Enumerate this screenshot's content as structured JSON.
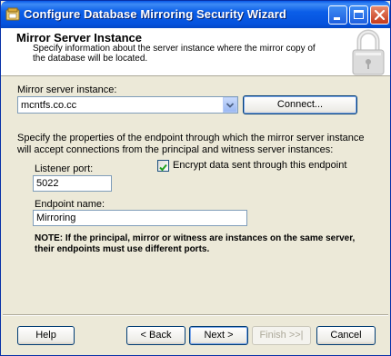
{
  "window": {
    "title": "Configure Database Mirroring Security Wizard",
    "caption_buttons": [
      "minimize-icon",
      "maximize-icon",
      "close-icon"
    ]
  },
  "header": {
    "title": "Mirror Server Instance",
    "description": "Specify information about the server instance where the mirror copy of the database will be located.",
    "icon": "padlock-icon"
  },
  "mirror": {
    "label": "Mirror server instance:",
    "value": "mcntfs.co.cc",
    "connect_label": "Connect..."
  },
  "endpoint": {
    "description": "Specify the properties of the endpoint through which the mirror server instance will accept connections from the principal and witness server instances:",
    "listener_label": "Listener port:",
    "listener_value": "5022",
    "encrypt_label": "Encrypt data sent through this endpoint",
    "encrypt_checked": true,
    "name_label": "Endpoint name:",
    "name_value": "Mirroring",
    "note": "NOTE: If the principal, mirror or witness are instances on the same server, their endpoints must use different ports."
  },
  "footer": {
    "help": "Help",
    "back": "< Back",
    "next": "Next >",
    "finish": "Finish >>|",
    "cancel": "Cancel"
  },
  "colors": {
    "titlebar": "#0a5ae9",
    "dialog_bg": "#ece9d8",
    "header_bg": "#ffffff",
    "checkmark": "#21a121"
  }
}
